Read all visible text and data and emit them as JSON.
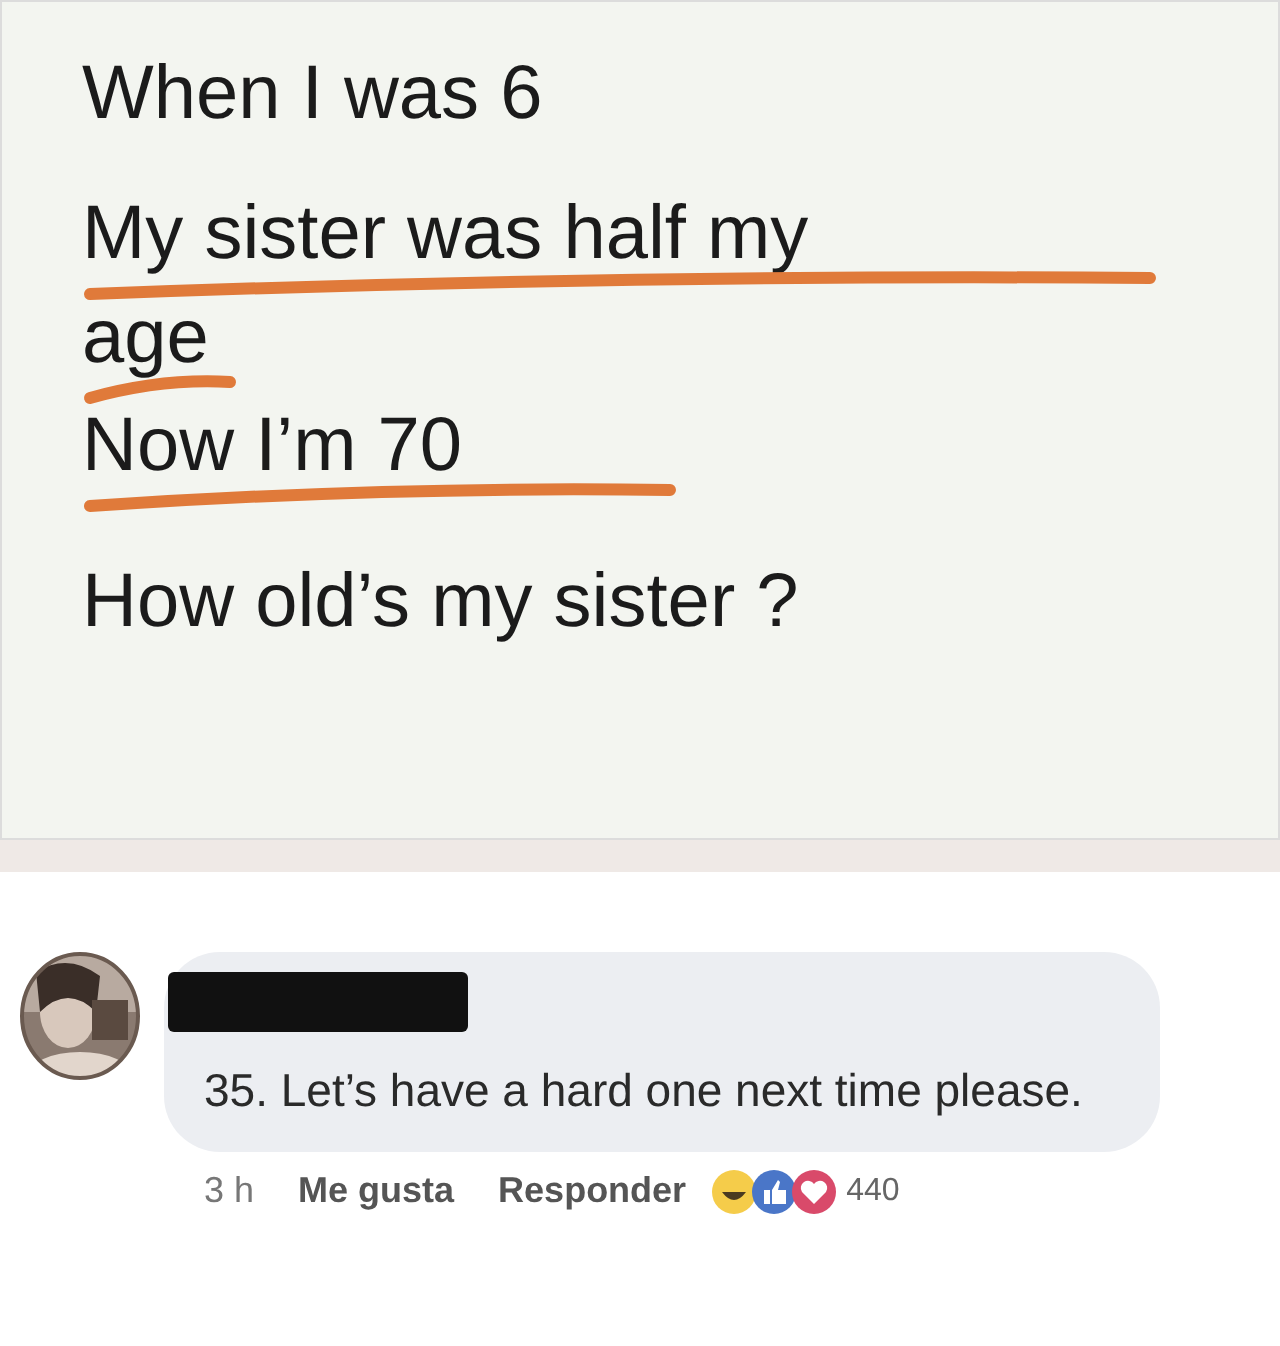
{
  "post": {
    "lines": [
      {
        "text": "When I was 6",
        "marked": false
      },
      {
        "text": "My sister was half my",
        "marked": true
      },
      {
        "text": "age",
        "marked": true
      },
      {
        "text": "Now I’m 70",
        "marked": true
      },
      {
        "text": "How old’s my sister ?",
        "marked": false
      }
    ]
  },
  "comment": {
    "author_redacted": true,
    "text": "35. Let’s have a hard one next time please.",
    "time": "3 h",
    "actions": [
      "Me gusta",
      "Responder"
    ],
    "reaction_count": "440"
  }
}
